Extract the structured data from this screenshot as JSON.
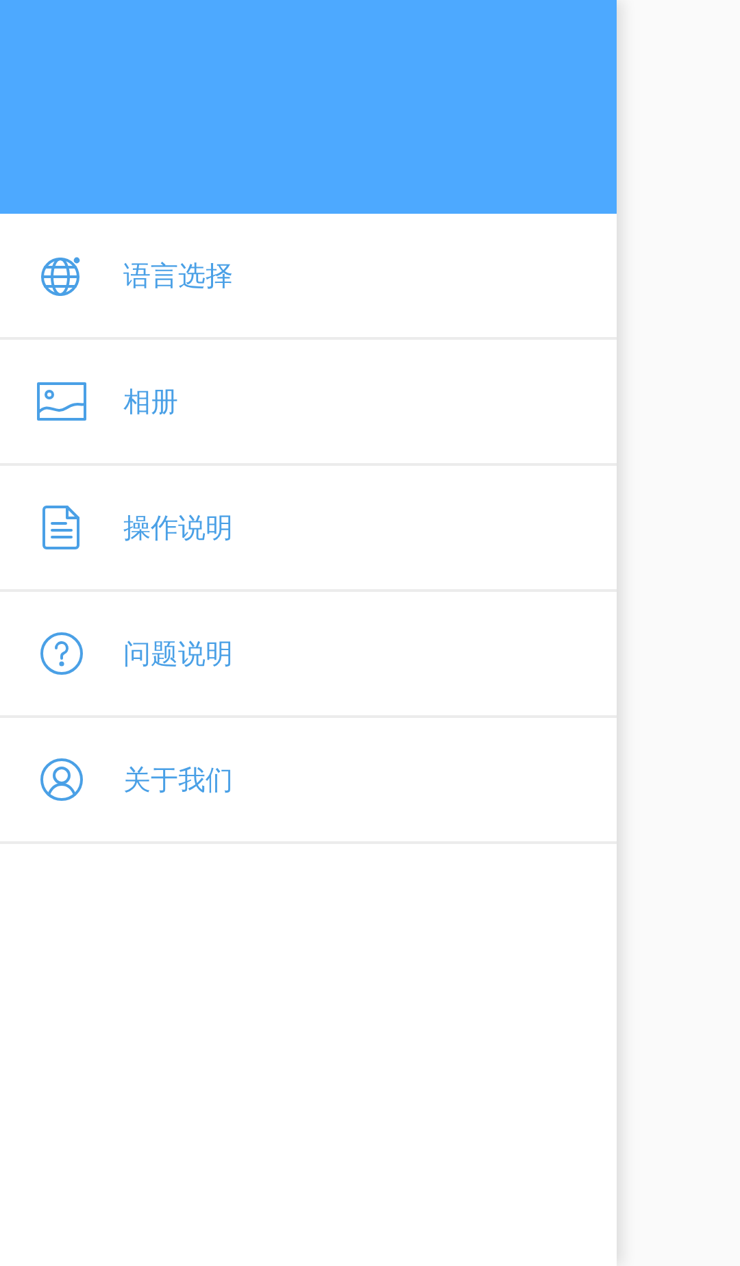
{
  "menu": [
    {
      "kind": "globe",
      "label": "语言选择"
    },
    {
      "kind": "image",
      "label": "相册"
    },
    {
      "kind": "document",
      "label": "操作说明"
    },
    {
      "kind": "question",
      "label": "问题说明"
    },
    {
      "kind": "user",
      "label": "关于我们"
    }
  ]
}
